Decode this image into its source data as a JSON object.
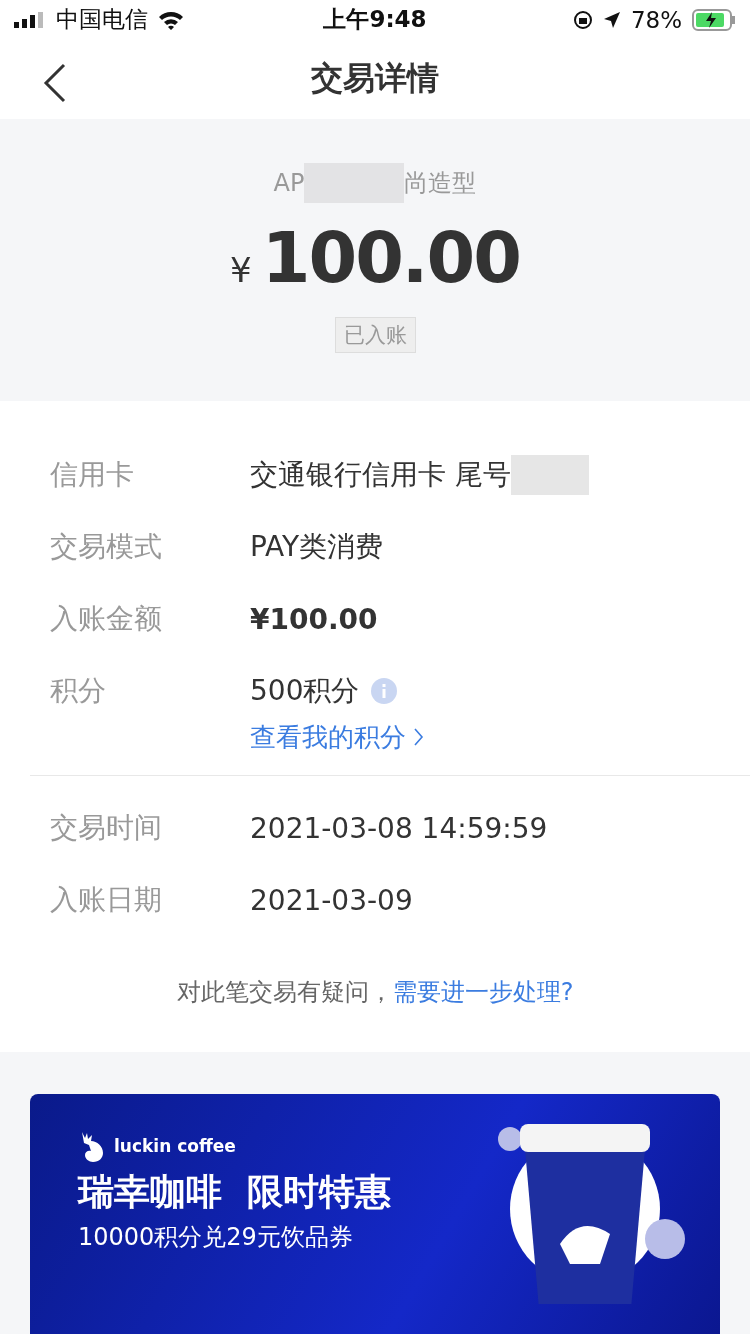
{
  "status_bar": {
    "carrier": "中国电信",
    "time": "上午9:48",
    "battery": "78%"
  },
  "nav": {
    "title": "交易详情"
  },
  "summary": {
    "merchant_start": "AP",
    "merchant_end": "尚造型",
    "currency": "¥",
    "amount": "100.00",
    "status": "已入账"
  },
  "details": [
    {
      "kind": "text",
      "label": "信用卡",
      "value": "交通银行信用卡 尾号",
      "redacted": true
    },
    {
      "kind": "text",
      "label": "交易模式",
      "value": "PAY类消费",
      "redacted": false
    },
    {
      "kind": "bold",
      "label": "入账金额",
      "value": "¥100.00",
      "redacted": false
    },
    {
      "kind": "points",
      "label": "积分",
      "value": "500积分",
      "link": "查看我的积分",
      "redacted": false
    }
  ],
  "times": [
    {
      "label": "交易时间",
      "value": "2021-03-08 14:59:59"
    },
    {
      "label": "入账日期",
      "value": "2021-03-09"
    }
  ],
  "footer": {
    "question": "对此笔交易有疑问，",
    "link": "需要进一步处理?"
  },
  "banner": {
    "brand": "luckin coffee",
    "headline": "瑞幸咖啡  限时特惠",
    "offer": "10000积分兑29元饮品券"
  }
}
